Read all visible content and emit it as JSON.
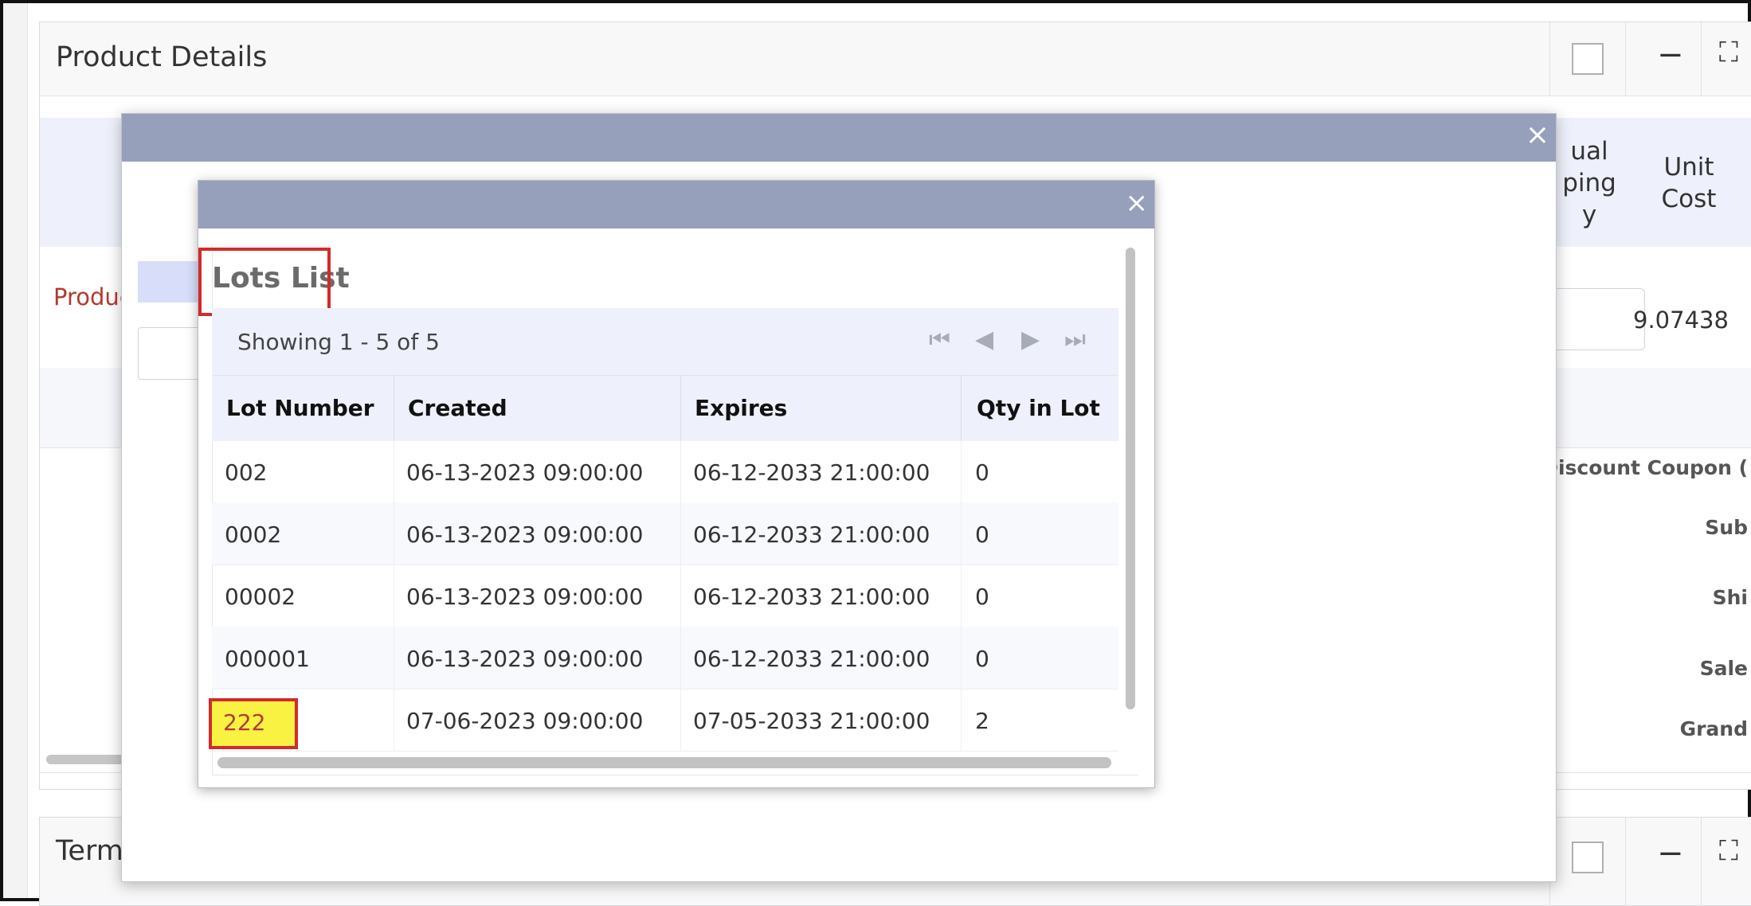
{
  "panel": {
    "title": "Product Details",
    "product_link": "Produc",
    "col_shipping": "ual\nping\ny",
    "col_unit_cost": "Unit\nCost",
    "unit_cost_value": "9.07438",
    "summary": [
      "Discount Coupon (",
      "Sub",
      "Shi",
      "Sale",
      "Grand"
    ],
    "minus_glyph": "−",
    "expand_glyph": "⛶"
  },
  "panel2": {
    "title": "Term"
  },
  "outer_dialog": {
    "close_glyph": "×"
  },
  "inner_dialog": {
    "close_glyph": "×",
    "title": "Lots List",
    "pager": {
      "text": "Showing 1 - 5 of 5",
      "first": "⏮",
      "prev": "◀",
      "next": "▶",
      "last": "⏭"
    },
    "columns": [
      "Lot Number",
      "Created",
      "Expires",
      "Qty in Lot"
    ],
    "rows": [
      [
        "002",
        "06-13-2023 09:00:00",
        "06-12-2033 21:00:00",
        "0"
      ],
      [
        "0002",
        "06-13-2023 09:00:00",
        "06-12-2033 21:00:00",
        "0"
      ],
      [
        "00002",
        "06-13-2023 09:00:00",
        "06-12-2033 21:00:00",
        "0"
      ],
      [
        "000001",
        "06-13-2023 09:00:00",
        "06-12-2033 21:00:00",
        "0"
      ],
      [
        "222",
        "07-06-2023 09:00:00",
        "07-05-2033 21:00:00",
        "2"
      ]
    ]
  },
  "colors": {
    "titlebar": "#97a0ba",
    "header_band": "#eef1fb",
    "highlight_yellow": "#f9f243",
    "annotation_red": "#d42a2a",
    "link_red": "#b23a30"
  }
}
